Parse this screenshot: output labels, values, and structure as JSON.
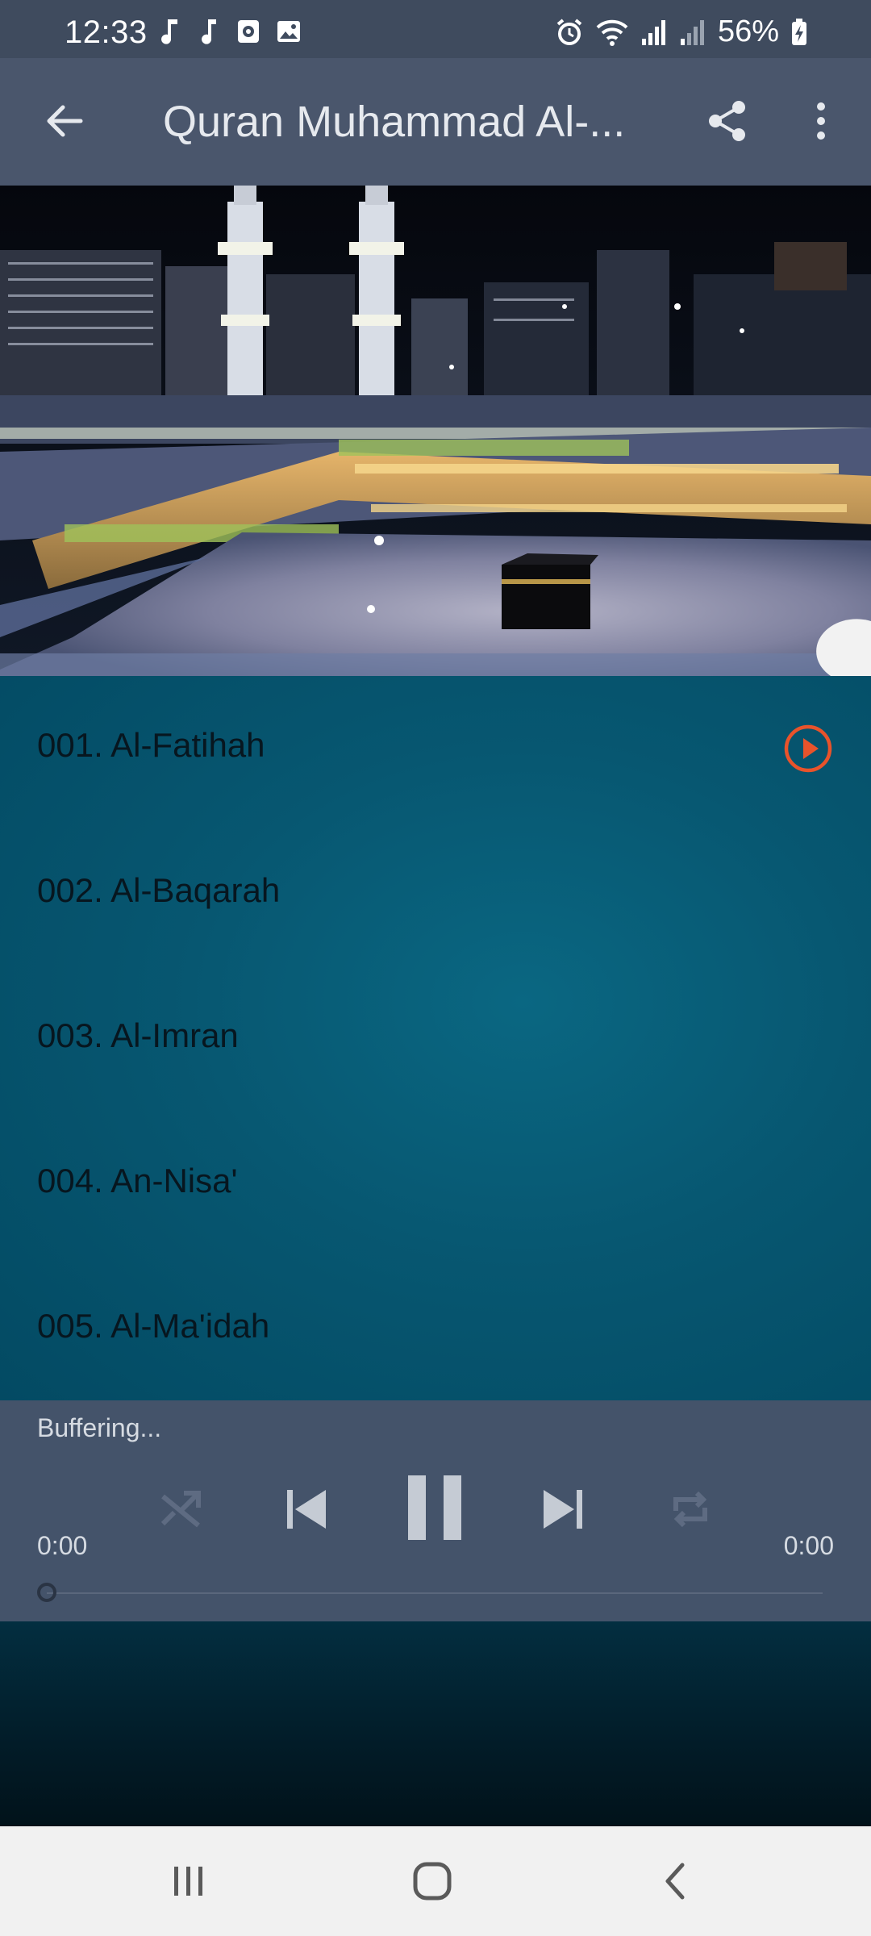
{
  "status_bar": {
    "time": "12:33",
    "battery": "56%",
    "icons": [
      "music-note-icon",
      "music-note-icon",
      "media-icon",
      "image-icon",
      "alarm-icon",
      "wifi-icon",
      "signal-icon",
      "signal-icon",
      "battery-charging-icon"
    ]
  },
  "app_bar": {
    "title": "Quran Muhammad Al-...",
    "back_icon": "arrow-back-icon",
    "share_icon": "share-icon",
    "more_icon": "more-vert-icon"
  },
  "surah_list": [
    {
      "label": "001. Al-Fatihah",
      "playing_indicator": true
    },
    {
      "label": "002. Al-Baqarah",
      "playing_indicator": false
    },
    {
      "label": "003. Al-Imran",
      "playing_indicator": false
    },
    {
      "label": "004. An-Nisa'",
      "playing_indicator": false
    },
    {
      "label": "005. Al-Ma'idah",
      "playing_indicator": false
    }
  ],
  "player": {
    "status": "Buffering...",
    "elapsed": "0:00",
    "duration": "0:00",
    "progress": 0
  },
  "colors": {
    "accent": "#e8532b",
    "status_bar": "#3f4b5e",
    "app_bar": "#4a566c",
    "player_bg": "#44536a",
    "list_bg": "#075771"
  }
}
